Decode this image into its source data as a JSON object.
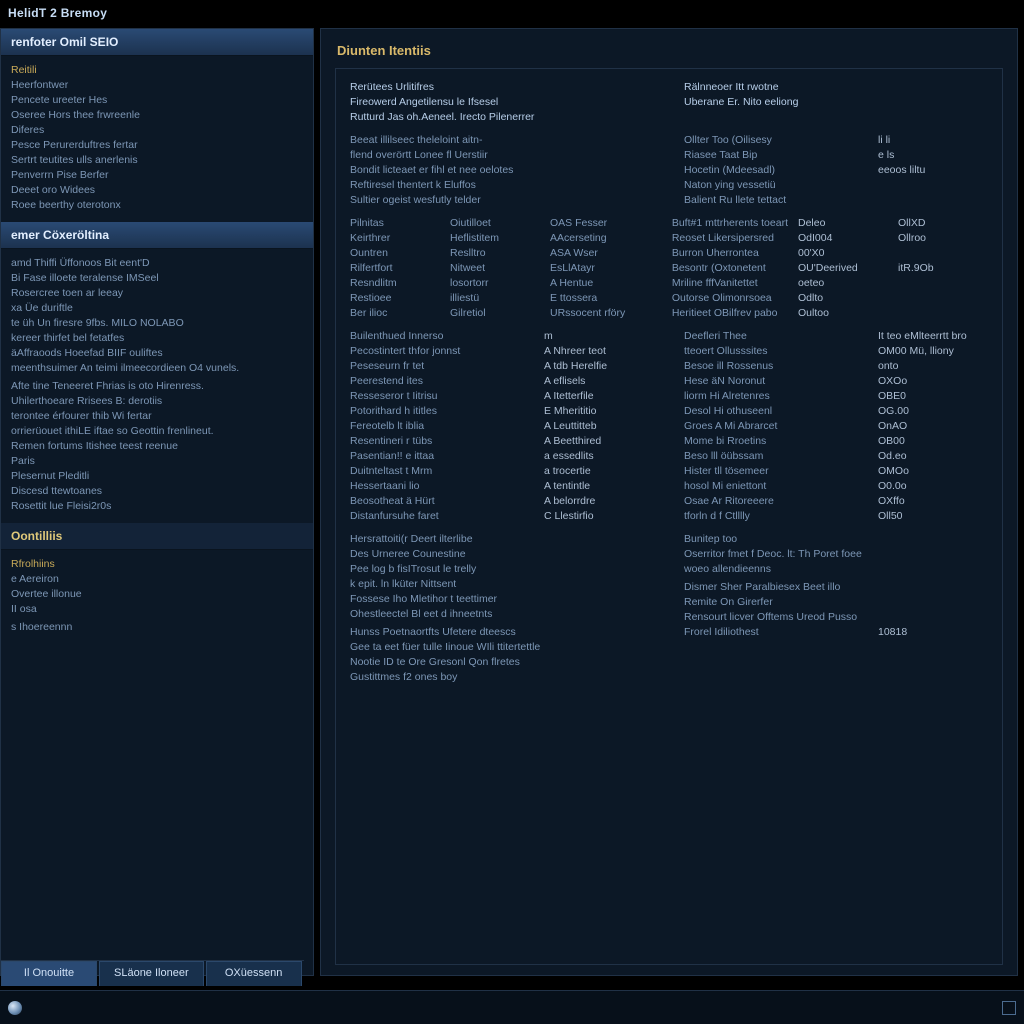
{
  "window": {
    "title": "HelidT 2 Bremoy"
  },
  "sidebar": {
    "header1": "renfoter Omil SEIO",
    "group1_title": "Reitili",
    "group1_items": [
      "Heerfontwer",
      "Pencete ureeter Hes",
      "Oseree Hors thee frwreenle",
      "Diferes",
      "Pesce Perurerduftres fertar",
      "Sertrt teutites ulls anerlenis",
      "Penverrn Pise Berfer",
      "Deeet oro Widees",
      "Roee beerthy oterotonx"
    ],
    "header2": "emer Cöxeröltina",
    "group2_items": [
      "amd Thiffi Üffonoos Bit eent'D",
      "Bi     Fase illoete teralense IMSeel",
      "      Rosercree toen ar leeay",
      "xa    Üe duriftle",
      "te üh    Un firesre 9fbs. MILO NOLABO",
      "  kereer thirfet bel fetatfes",
      "  äAffraoods Hoeefad BIIF ouliftes",
      "meenthsuimer An teimi ilmeecordieen   O4 vunels.",
      "",
      "Afte tine Teneeret Fhrias is oto Hirenress.",
      "Uhilerthoeare Rrisees B: derotiis",
      "terontee érfourer thib   Wi fertar",
      "orrierüouet ithiLE iftae   so Geottin frenlineut.",
      "Remen fortums Itishee teest reenue",
      "Paris",
      "Plesernut Pleditli",
      "Discesd ttewtoanes",
      "Rosettit lue Fleisi2r0s"
    ],
    "header3": "Oontilliis",
    "group3_items": [
      "Rfrolhiins",
      "e  Aereiron",
      "  Overtee illonue",
      "   II osa",
      "",
      "s   Ihoereennn"
    ]
  },
  "tabs": {
    "a": "Il Onouitte",
    "b": "SLäone Iloneer",
    "c": "OXüessenn"
  },
  "main": {
    "title": "Diunten Itentiis",
    "block1": {
      "left": [
        "Rerütees Urlitifres",
        "Fireowerd Angetilensu le Ifsesel",
        "Rutturd Jas oh.Aeneel.  Irecto Pilenerrer"
      ],
      "right": [
        "Rälnneoer Itt rwotne",
        "Uberane Er. Nito eeliong"
      ]
    },
    "block2": {
      "left": [
        "Beeat illilseec  theleloint  aitn-",
        "flend overörtt   Lonee fl Uerstiir",
        "Bondit licteaet   er fihl et nee oelotes",
        "Reftiresel thentert k Eluffos",
        "Sultier ogeist wesfutly telder"
      ],
      "right": [
        {
          "k": "Ollter Too (Oilisesy",
          "v": "li li"
        },
        {
          "k": "Riasee Taat Bip",
          "v": "e ls"
        },
        {
          "k": "Hocetin (Mdeesadl)",
          "v": "eeoos liltu"
        },
        {
          "k": "Naton   ying vessetiü",
          "v": ""
        },
        {
          "k": "Balient  Ru llete tettact",
          "v": ""
        }
      ]
    },
    "block3": {
      "left": [
        {
          "a": "Pilnitas",
          "b": "Oiutilloet",
          "c": "OAS Fesser"
        },
        {
          "a": "Keirthrer",
          "b": "Heflistitem",
          "c": "AAcerseting"
        },
        {
          "a": "Ountren",
          "b": "Reslltro",
          "c": "ASA Wser"
        },
        {
          "a": "Rilfertfort",
          "b": "Nitweet",
          "c": "EsLlAtayr"
        },
        {
          "a": "Resndlitm",
          "b": "losortorr",
          "c": "A Hentue"
        },
        {
          "a": "Restioee",
          "b": "illiestü",
          "c": "E ttossera"
        },
        {
          "a": "Ber ilioc",
          "b": "Gilretiol",
          "c": "URssocent rföry"
        }
      ],
      "right": [
        {
          "k": "Buft#1 mttrherents toeart",
          "v1": "Deleo",
          "v2": "OllXD"
        },
        {
          "k": "Reoset  Likersipersred",
          "v1": "OdI004",
          "v2": "Ollroo"
        },
        {
          "k": "Burron Uherrontea",
          "v1": "00'X0",
          "v2": ""
        },
        {
          "k": "Besontr (Oxtonetent",
          "v1": "OU'Deerived",
          "v2": "itR.9Ob"
        },
        {
          "k": "Mriline fffVanitettet",
          "v1": "oeteo",
          "v2": ""
        },
        {
          "k": "Outorse Olimonrsoea",
          "v1": "Odlto",
          "v2": ""
        },
        {
          "k": "Heritieet   OBilfrev pabo",
          "v1": "Oultoo",
          "v2": ""
        }
      ]
    },
    "block4": {
      "left": [
        {
          "k": "Builenthued  Innerso",
          "v": "m"
        },
        {
          "k": "Pecostintert  thfor jonnst",
          "v": "A   Nhreer teot"
        },
        {
          "k": "Peseseurn fr tet",
          "v": "A   tdb Herelfie"
        },
        {
          "k": "Peerestend   ites",
          "v": "A   eflisels"
        },
        {
          "k": "Resseseror t Iitrisu",
          "v": "A   Itetterfile"
        },
        {
          "k": "Potorithard h ititles",
          "v": "E   Mherititio"
        },
        {
          "k": "Fereotelb   lt iblia",
          "v": "A   Leuttitteb"
        },
        {
          "k": "Resentineri r tübs",
          "v": "A   Beetthired"
        },
        {
          "k": "Pasentian!! e ittaa",
          "v": "a   essedlits"
        },
        {
          "k": "Duitnteltast t Mrm",
          "v": "a   trocertie"
        },
        {
          "k": "Hessertaani   lio",
          "v": "A  tentintle"
        },
        {
          "k": "Beosotheat   ä Hürt",
          "v": "A   belorrdre"
        },
        {
          "k": "Distanfursuhe faret",
          "v": "C Llestirfio"
        }
      ],
      "right": [
        {
          "k": "Deefleri Thee",
          "v1": "It teo   eMlteerrtt bro"
        },
        {
          "k": "tteoert  Ollusssites",
          "v1": "OM00   Mü, lliony"
        },
        {
          "k": "Besoe  ill Rossenus",
          "v1": "onto"
        },
        {
          "k": "Hese  äN Noronut",
          "v1": "OXOo"
        },
        {
          "k": "liorm   Hi Alretenres",
          "v1": "OBE0"
        },
        {
          "k": "Desol   Hi othuseenl",
          "v1": "OG.00"
        },
        {
          "k": "Groes A Mi Abrarcet",
          "v1": "OnAO"
        },
        {
          "k": "Mome  bi Rroetins",
          "v1": "OB00"
        },
        {
          "k": "Beso   lll öübssam",
          "v1": "Od.eo"
        },
        {
          "k": "Hister  tll tösemeer",
          "v1": "OMOo"
        },
        {
          "k": "hosol  Mi eniettont",
          "v1": "O0.0o"
        },
        {
          "k": "Osae  Ar Ritoreeere",
          "v1": "OXffo"
        },
        {
          "k": "tforln  d  f Ctlllly",
          "v1": "Oll50"
        }
      ]
    },
    "block5": {
      "left": [
        "Hersrattoiti(r Deert ilterlibe",
        "Des   Urneree Counestine",
        "Pee   log b fisITrosut le trelly",
        "k epit.  ln lküter  Nittsent",
        "Fossese  Iho Mletihor t teettimer",
        "Ohestleectel   Bl eet d ihneetnts",
        "",
        "Hunss   Poetnaortfts Ufetere dteescs",
        "Gee ta  eet füer tulle Iinoue WIli ttitertettle",
        "Nootie ID te  Ore Gresonl   Qon flretes",
        "Gustittmes f2 ones boy"
      ],
      "right": [
        {
          "k": "Bunitep too",
          "v": ""
        },
        {
          "k": "Oserritor  fmet f Deoc. lt: Th Poret foee",
          "v": ""
        },
        {
          "k": "woeo    allendieenns",
          "v": ""
        },
        {
          "k": "",
          "v": ""
        },
        {
          "k": "Dismer Sher Paralbiesex  Beet illo",
          "v": ""
        },
        {
          "k": "Remite  On Girerfer",
          "v": ""
        },
        {
          "k": "Rensourt licver Offtems   Ureod Pusso",
          "v": ""
        },
        {
          "k": "Frorel Idiliothest",
          "v": "10818"
        }
      ]
    }
  }
}
